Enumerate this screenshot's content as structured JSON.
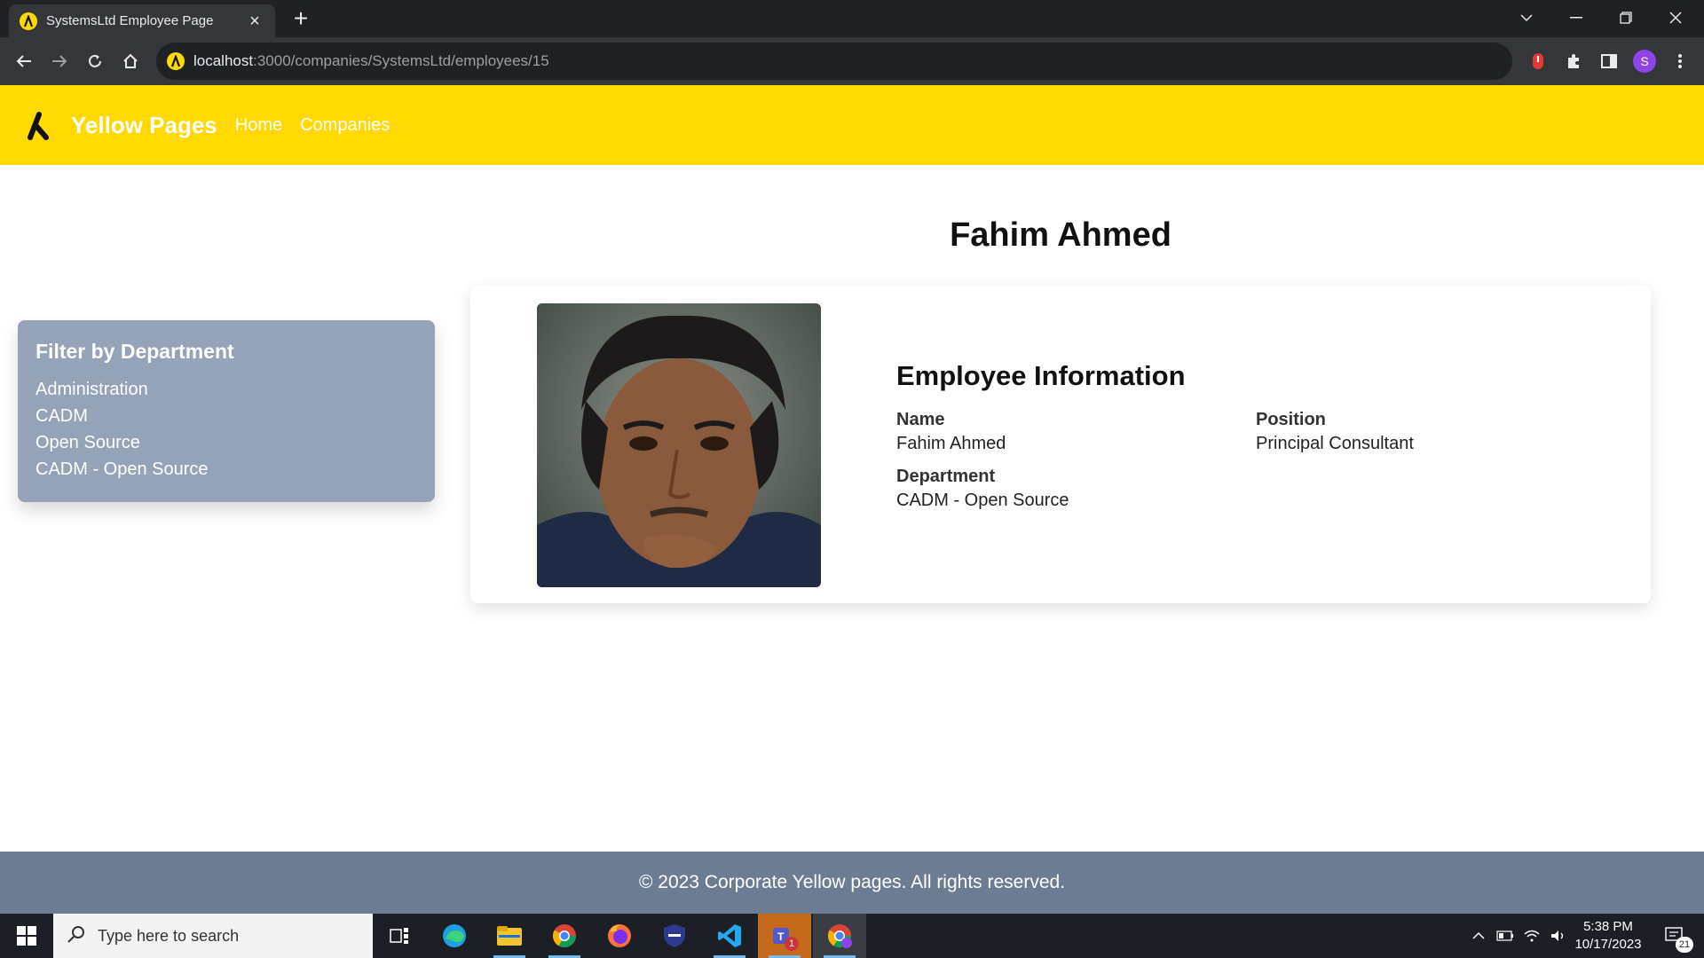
{
  "browser": {
    "tab_title": "SystemsLtd Employee Page",
    "url_host": "localhost",
    "url_path": ":3000/companies/SystemsLtd/employees/15",
    "profile_initial": "S"
  },
  "site": {
    "brand": "Yellow Pages",
    "nav": [
      "Home",
      "Companies"
    ]
  },
  "employee": {
    "page_title": "Fahim Ahmed",
    "section_title": "Employee Information",
    "name_label": "Name",
    "name_value": "Fahim Ahmed",
    "position_label": "Position",
    "position_value": "Principal Consultant",
    "department_label": "Department",
    "department_value": "CADM - Open Source"
  },
  "filter": {
    "title": "Filter by Department",
    "departments": [
      "Administration",
      "CADM",
      "Open Source",
      "CADM - Open Source"
    ]
  },
  "footer": {
    "text": "© 2023 Corporate Yellow pages. All rights reserved."
  },
  "taskbar": {
    "search_placeholder": "Type here to search",
    "time": "5:38 PM",
    "date": "10/17/2023",
    "notification_count": "21",
    "teams_badge": "1"
  },
  "colors": {
    "brand_yellow": "#ffd900",
    "filter_bg": "#94a3b8",
    "footer_bg": "#6b7c93"
  }
}
